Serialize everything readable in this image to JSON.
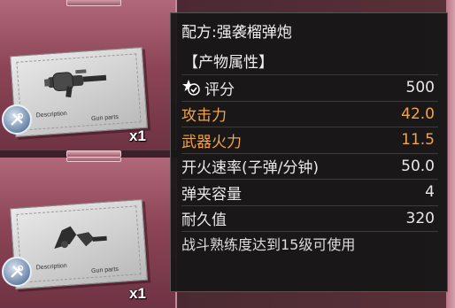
{
  "inventory": {
    "slots": [
      {
        "icon": "grenade-launcher-blueprint-icon",
        "quantity": "x1",
        "desc": "Description",
        "parts": "Gun parts"
      },
      {
        "icon": "weapon-part-blueprint-icon",
        "quantity": "x1",
        "desc": "Description",
        "parts": "Gun parts"
      }
    ]
  },
  "tooltip": {
    "title": "配方:强袭榴弹炮",
    "section": "【产物属性】",
    "stats": [
      {
        "label": "评分",
        "value": "500",
        "icon": "score-icon",
        "highlight": false
      },
      {
        "label": "攻击力",
        "value": "42.0",
        "highlight": true
      },
      {
        "label": "武器火力",
        "value": "11.5",
        "highlight": true
      },
      {
        "label": "开火速率(子弹/分钟)",
        "value": "50.0",
        "highlight": false
      },
      {
        "label": "弹夹容量",
        "value": "4",
        "highlight": false
      },
      {
        "label": "耐久值",
        "value": "320",
        "highlight": false
      }
    ],
    "requirement": "战斗熟练度达到15级可使用"
  },
  "colors": {
    "highlight": "#f2a44a",
    "panel_bg": "#161616",
    "slot_bg": "#8c4556"
  }
}
